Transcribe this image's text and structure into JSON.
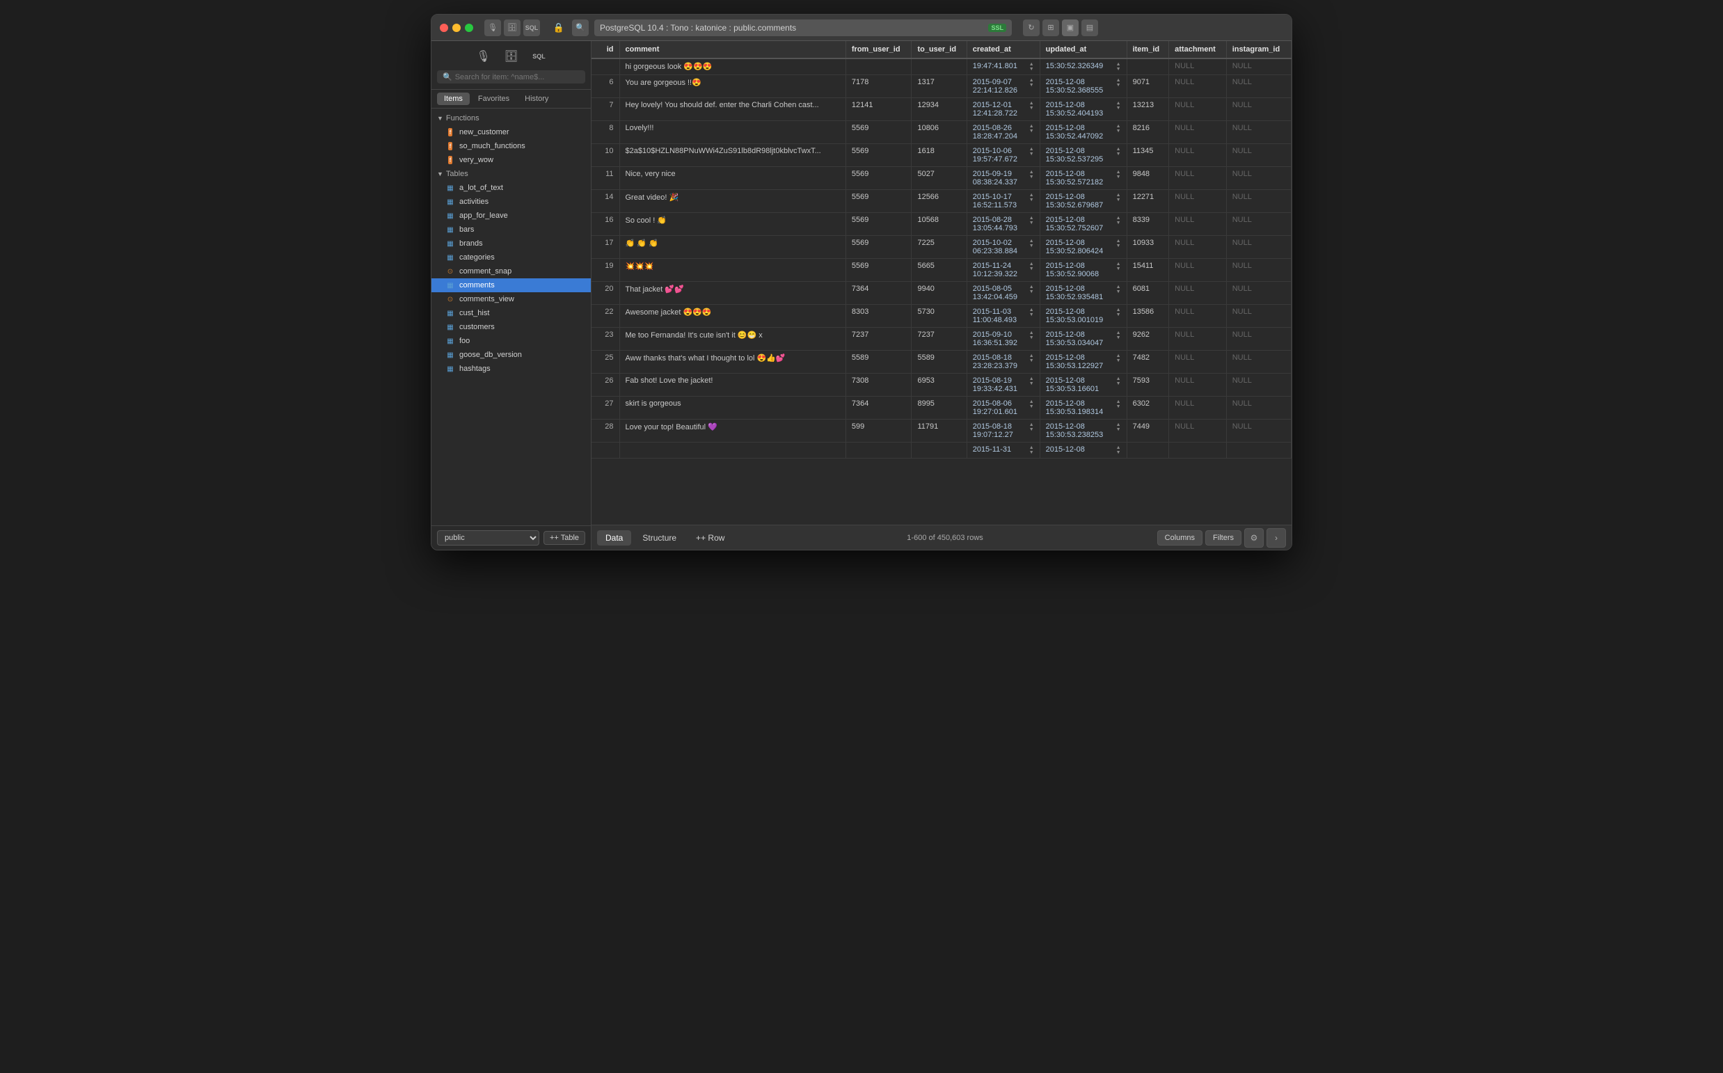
{
  "titlebar": {
    "title": "PostgreSQL 10.4 : Tono : katonice : public.comments",
    "ssl_badge": "SSL",
    "search_placeholder": "Search for item: ^name$..."
  },
  "sidebar": {
    "search_placeholder": "Search for item: ^name$...",
    "tabs": [
      "Items",
      "Favorites",
      "History"
    ],
    "active_tab": "Items",
    "sections": {
      "functions": {
        "label": "Functions",
        "items": [
          "new_customer",
          "so_much_functions",
          "very_wow"
        ]
      },
      "tables": {
        "label": "Tables",
        "items": [
          "a_lot_of_text",
          "activities",
          "app_for_leave",
          "bars",
          "brands",
          "categories",
          "comment_snap",
          "comments",
          "comments_view",
          "cust_hist",
          "customers",
          "foo",
          "goose_db_version",
          "hashtags"
        ],
        "active": "comments"
      }
    },
    "schema": "public",
    "add_table_label": "+ Table"
  },
  "table": {
    "columns": [
      "id",
      "comment",
      "from_user_id",
      "to_user_id",
      "created_at",
      "updated_at",
      "item_id",
      "attachment",
      "instagram_id"
    ],
    "rows": [
      {
        "id": "",
        "comment": "hi gorgeous look 😍😍😍",
        "from_user_id": "",
        "to_user_id": "",
        "created_at": "19:47:41.801",
        "updated_at": "15:30:52.326349",
        "item_id": "",
        "attachment": "NULL",
        "instagram_id": "NULL"
      },
      {
        "id": "6",
        "comment": "You are gorgeous !!😍",
        "from_user_id": "7178",
        "to_user_id": "1317",
        "created_at": "2015-09-07\n22:14:12.826",
        "updated_at": "2015-12-08\n15:30:52.368555",
        "item_id": "9071",
        "attachment": "NULL",
        "instagram_id": "NULL"
      },
      {
        "id": "7",
        "comment": "Hey lovely! You should def. enter the Charli Cohen cast...",
        "from_user_id": "12141",
        "to_user_id": "12934",
        "created_at": "2015-12-01\n12:41:28.722",
        "updated_at": "2015-12-08\n15:30:52.404193",
        "item_id": "13213",
        "attachment": "NULL",
        "instagram_id": "NULL"
      },
      {
        "id": "8",
        "comment": "Lovely!!!",
        "from_user_id": "5569",
        "to_user_id": "10806",
        "created_at": "2015-08-26\n18:28:47.204",
        "updated_at": "2015-12-08\n15:30:52.447092",
        "item_id": "8216",
        "attachment": "NULL",
        "instagram_id": "NULL"
      },
      {
        "id": "10",
        "comment": "$2a$10$HZLN88PNuWWi4ZuS91lb8dR98ljt0kblvcTwxT...",
        "from_user_id": "5569",
        "to_user_id": "1618",
        "created_at": "2015-10-06\n19:57:47.672",
        "updated_at": "2015-12-08\n15:30:52.537295",
        "item_id": "11345",
        "attachment": "NULL",
        "instagram_id": "NULL"
      },
      {
        "id": "11",
        "comment": "Nice, very nice",
        "from_user_id": "5569",
        "to_user_id": "5027",
        "created_at": "2015-09-19\n08:38:24.337",
        "updated_at": "2015-12-08\n15:30:52.572182",
        "item_id": "9848",
        "attachment": "NULL",
        "instagram_id": "NULL"
      },
      {
        "id": "14",
        "comment": "Great video! 🎉",
        "from_user_id": "5569",
        "to_user_id": "12566",
        "created_at": "2015-10-17\n16:52:11.573",
        "updated_at": "2015-12-08\n15:30:52.679687",
        "item_id": "12271",
        "attachment": "NULL",
        "instagram_id": "NULL"
      },
      {
        "id": "16",
        "comment": "So cool ! 👏",
        "from_user_id": "5569",
        "to_user_id": "10568",
        "created_at": "2015-08-28\n13:05:44.793",
        "updated_at": "2015-12-08\n15:30:52.752607",
        "item_id": "8339",
        "attachment": "NULL",
        "instagram_id": "NULL"
      },
      {
        "id": "17",
        "comment": "👏 👏 👏",
        "from_user_id": "5569",
        "to_user_id": "7225",
        "created_at": "2015-10-02\n06:23:38.884",
        "updated_at": "2015-12-08\n15:30:52.806424",
        "item_id": "10933",
        "attachment": "NULL",
        "instagram_id": "NULL"
      },
      {
        "id": "19",
        "comment": "💥💥💥",
        "from_user_id": "5569",
        "to_user_id": "5665",
        "created_at": "2015-11-24\n10:12:39.322",
        "updated_at": "2015-12-08\n15:30:52.90068",
        "item_id": "15411",
        "attachment": "NULL",
        "instagram_id": "NULL"
      },
      {
        "id": "20",
        "comment": "That jacket 💕💕",
        "from_user_id": "7364",
        "to_user_id": "9940",
        "created_at": "2015-08-05\n13:42:04.459",
        "updated_at": "2015-12-08\n15:30:52.935481",
        "item_id": "6081",
        "attachment": "NULL",
        "instagram_id": "NULL"
      },
      {
        "id": "22",
        "comment": "Awesome jacket 😍😍😍",
        "from_user_id": "8303",
        "to_user_id": "5730",
        "created_at": "2015-11-03\n11:00:48.493",
        "updated_at": "2015-12-08\n15:30:53.001019",
        "item_id": "13586",
        "attachment": "NULL",
        "instagram_id": "NULL"
      },
      {
        "id": "23",
        "comment": "Me too Fernanda! It's cute isn't it 😊😁 x",
        "from_user_id": "7237",
        "to_user_id": "7237",
        "created_at": "2015-09-10\n16:36:51.392",
        "updated_at": "2015-12-08\n15:30:53.034047",
        "item_id": "9262",
        "attachment": "NULL",
        "instagram_id": "NULL"
      },
      {
        "id": "25",
        "comment": "Aww thanks that's what I thought to lol 😍👍💕",
        "from_user_id": "5589",
        "to_user_id": "5589",
        "created_at": "2015-08-18\n23:28:23.379",
        "updated_at": "2015-12-08\n15:30:53.122927",
        "item_id": "7482",
        "attachment": "NULL",
        "instagram_id": "NULL"
      },
      {
        "id": "26",
        "comment": "Fab shot! Love the jacket!",
        "from_user_id": "7308",
        "to_user_id": "6953",
        "created_at": "2015-08-19\n19:33:42.431",
        "updated_at": "2015-12-08\n15:30:53.16601",
        "item_id": "7593",
        "attachment": "NULL",
        "instagram_id": "NULL"
      },
      {
        "id": "27",
        "comment": "skirt is gorgeous",
        "from_user_id": "7364",
        "to_user_id": "8995",
        "created_at": "2015-08-06\n19:27:01.601",
        "updated_at": "2015-12-08\n15:30:53.198314",
        "item_id": "6302",
        "attachment": "NULL",
        "instagram_id": "NULL"
      },
      {
        "id": "28",
        "comment": "Love your top! Beautiful 💜",
        "from_user_id": "599",
        "to_user_id": "11791",
        "created_at": "2015-08-18\n19:07:12.27",
        "updated_at": "2015-12-08\n15:30:53.238253",
        "item_id": "7449",
        "attachment": "NULL",
        "instagram_id": "NULL"
      },
      {
        "id": "",
        "comment": "",
        "from_user_id": "",
        "to_user_id": "",
        "created_at": "2015-11-31",
        "updated_at": "2015-12-08",
        "item_id": "",
        "attachment": "",
        "instagram_id": ""
      }
    ]
  },
  "bottom_bar": {
    "tabs": [
      "Data",
      "Structure"
    ],
    "active_tab": "Data",
    "add_row_label": "+ Row",
    "row_count": "1-600 of 450,603 rows",
    "buttons": [
      "Columns",
      "Filters"
    ],
    "gear_icon": "⚙",
    "nav_next": "›"
  }
}
